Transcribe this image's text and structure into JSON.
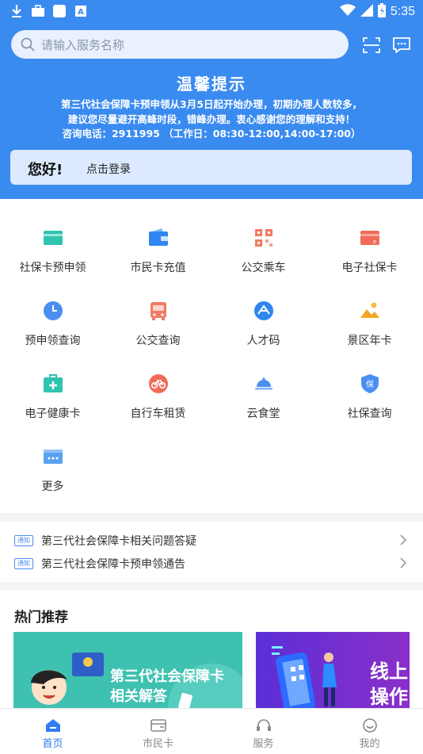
{
  "status_bar": {
    "time": "5:35",
    "left_icons": [
      "download-icon",
      "briefcase-icon",
      "square-app-icon",
      "a-app-icon"
    ],
    "right_icons": [
      "wifi-icon",
      "signal-icon",
      "battery-icon"
    ]
  },
  "search": {
    "placeholder": "请输入服务名称"
  },
  "header_icons": [
    "scan-icon",
    "message-icon"
  ],
  "notice": {
    "title": "温馨提示",
    "lines": [
      "第三代社会保障卡预申领从3月5日起开始办理，初期办理人数较多，",
      "建议您尽量避开高峰时段，错峰办理。衷心感谢您的理解和支持！",
      "咨询电话：2911995 （工作日：08:30-12:00,14:00-17:00）"
    ]
  },
  "login_card": {
    "greeting": "您好!",
    "login": "点击登录"
  },
  "services": [
    {
      "label": "社保卡预申领",
      "icon": "card-icon",
      "color": "#2fc3b0"
    },
    {
      "label": "市民卡充值",
      "icon": "wallet-icon",
      "color": "#2f86f0"
    },
    {
      "label": "公交乘车",
      "icon": "qr-code-icon",
      "color": "#f07b62"
    },
    {
      "label": "电子社保卡",
      "icon": "e-card-icon",
      "color": "#f06b5a"
    },
    {
      "label": "预申领查询",
      "icon": "clock-icon",
      "color": "#4a8ff0"
    },
    {
      "label": "公交查询",
      "icon": "bus-icon",
      "color": "#f07b62"
    },
    {
      "label": "人才码",
      "icon": "talent-icon",
      "color": "#2f86f0"
    },
    {
      "label": "景区年卡",
      "icon": "mountain-icon",
      "color": "#f5a623"
    },
    {
      "label": "电子健康卡",
      "icon": "medical-kit-icon",
      "color": "#2fc3b0"
    },
    {
      "label": "自行车租赁",
      "icon": "bicycle-icon",
      "color": "#f06b5a"
    },
    {
      "label": "云食堂",
      "icon": "dish-icon",
      "color": "#4a8ff0"
    },
    {
      "label": "社保查询",
      "icon": "shield-icon",
      "color": "#4a8ff0"
    },
    {
      "label": "更多",
      "icon": "more-icon",
      "color": "#5aa0f0"
    }
  ],
  "news": {
    "tag": "通知",
    "items": [
      "第三代社会保障卡相关问题答疑",
      "第三代社会保障卡预申领通告"
    ]
  },
  "hot": {
    "title": "热门推荐",
    "banners": [
      {
        "text_line1": "第三代社会保障卡",
        "text_line2": "相关解答",
        "color": "#3fc1b1"
      },
      {
        "text_line1": "线上",
        "text_line2": "操作",
        "color": "#6a2fd0"
      }
    ]
  },
  "tabs": [
    {
      "label": "首页",
      "icon": "home-icon",
      "active": true
    },
    {
      "label": "市民卡",
      "icon": "card-wallet-icon",
      "active": false
    },
    {
      "label": "服务",
      "icon": "headset-icon",
      "active": false
    },
    {
      "label": "我的",
      "icon": "smile-icon",
      "active": false
    }
  ],
  "colors": {
    "primary": "#3a8bf0",
    "active_tab": "#2f7df0"
  }
}
